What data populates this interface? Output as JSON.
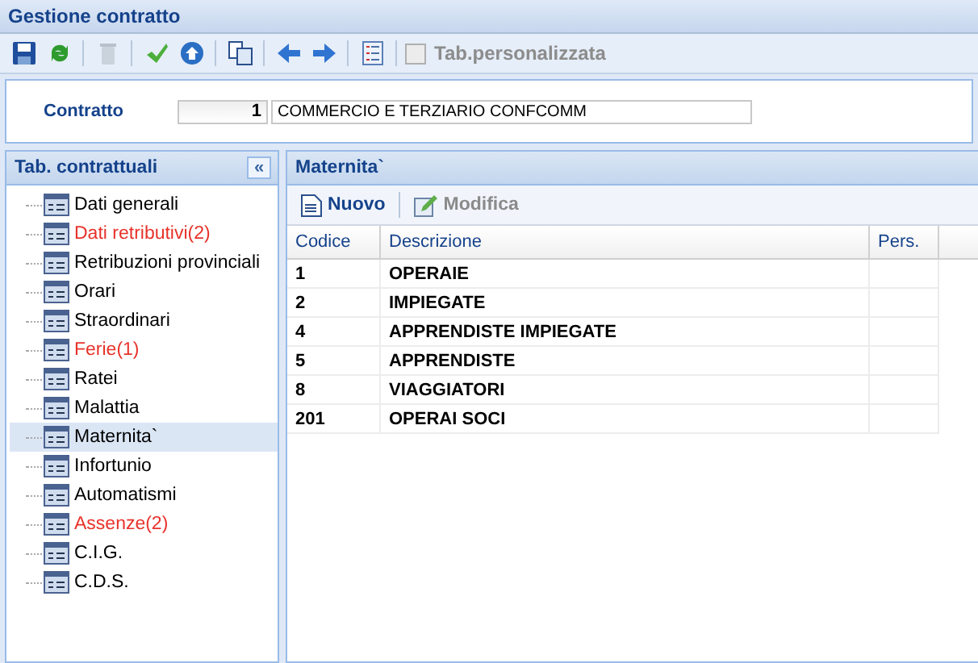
{
  "window": {
    "title": "Gestione contratto"
  },
  "toolbar": {
    "buttons": [
      {
        "disabled": false
      },
      {
        "disabled": false
      },
      {
        "disabled": true
      },
      {
        "disabled": false
      },
      {
        "disabled": false
      },
      {
        "disabled": false
      },
      {
        "disabled": false
      },
      {
        "disabled": false
      },
      {
        "disabled": false
      }
    ],
    "custom_tab": {
      "label": "Tab.personalizzata",
      "checked": false,
      "disabled": true
    }
  },
  "contract": {
    "label": "Contratto",
    "code": "1",
    "description": "COMMERCIO E TERZIARIO CONFCOMM"
  },
  "sidebar": {
    "title": "Tab. contrattuali",
    "collapse": "«",
    "items": [
      {
        "label": "Dati generali",
        "color": "#000000",
        "selected": false
      },
      {
        "label": "Dati retributivi(2)",
        "color": "#e8322a",
        "selected": false
      },
      {
        "label": "Retribuzioni provinciali",
        "color": "#000000",
        "selected": false
      },
      {
        "label": "Orari",
        "color": "#000000",
        "selected": false
      },
      {
        "label": "Straordinari",
        "color": "#000000",
        "selected": false
      },
      {
        "label": "Ferie(1)",
        "color": "#e8322a",
        "selected": false
      },
      {
        "label": "Ratei",
        "color": "#000000",
        "selected": false
      },
      {
        "label": "Malattia",
        "color": "#000000",
        "selected": false
      },
      {
        "label": "Maternita`",
        "color": "#000000",
        "selected": true
      },
      {
        "label": "Infortunio",
        "color": "#000000",
        "selected": false
      },
      {
        "label": "Automatismi",
        "color": "#000000",
        "selected": false
      },
      {
        "label": "Assenze(2)",
        "color": "#e8322a",
        "selected": false
      },
      {
        "label": "C.I.G.",
        "color": "#000000",
        "selected": false
      },
      {
        "label": "C.D.S.",
        "color": "#000000",
        "selected": false
      }
    ]
  },
  "panel": {
    "title": "Maternita`",
    "actions": [
      {
        "label": "Nuovo",
        "disabled": false
      },
      {
        "label": "Modifica",
        "disabled": true
      }
    ],
    "table": {
      "columns": [
        "Codice",
        "Descrizione",
        "Pers."
      ],
      "rows": [
        [
          "1",
          "OPERAIE",
          ""
        ],
        [
          "2",
          "IMPIEGATE",
          ""
        ],
        [
          "4",
          "APPRENDISTE IMPIEGATE",
          ""
        ],
        [
          "5",
          "APPRENDISTE",
          ""
        ],
        [
          "8",
          "VIAGGIATORI",
          ""
        ],
        [
          "201",
          "OPERAI SOCI",
          ""
        ]
      ]
    }
  }
}
